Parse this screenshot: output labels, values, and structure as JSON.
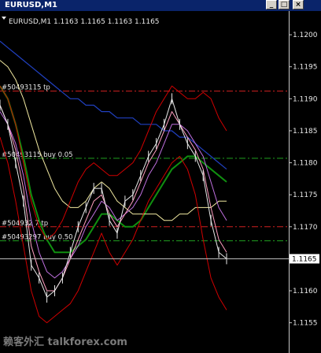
{
  "window": {
    "title": "EURUSD,M1",
    "min_label": "_",
    "max_label": "□",
    "close_label": "×"
  },
  "header": {
    "symbol_info": "EURUSD,M1  1.1163 1.1165 1.1163 1.1165"
  },
  "watermark": "赖客外汇 talkforex.com",
  "colors": {
    "background": "#000000",
    "price": "#e8e8e8",
    "bollinger": "#d00000",
    "ma_fast": "#ff9fc0",
    "ma_violet": "#c070e0",
    "ma_yellow": "#f0e8a0",
    "ma_green": "#109010",
    "ma_blue": "#2040c0",
    "tp_line": "#d02020",
    "buy_line": "#20a020"
  },
  "chart_data": {
    "type": "line",
    "title": "EURUSD,M1  1.1163 1.1165 1.1163 1.1165",
    "ylim": [
      1.1152,
      1.1201
    ],
    "yticks": [
      "1.1200",
      "1.1195",
      "1.1190",
      "1.1185",
      "1.1180",
      "1.1175",
      "1.1170",
      "1.1165",
      "1.1160",
      "1.1155"
    ],
    "current_price": "1.1165",
    "order_lines": [
      {
        "label": "#50493115 tp",
        "price": 1.11912,
        "kind": "tp"
      },
      {
        "label": "#50493115 buy 0.05",
        "price": 1.11807,
        "kind": "buy"
      },
      {
        "label": "#504932 7 tp",
        "price": 1.117,
        "kind": "tp"
      },
      {
        "label": "#50493297 buy 0.50",
        "price": 1.11678,
        "kind": "buy"
      }
    ],
    "x": [
      0,
      10,
      20,
      30,
      40,
      50,
      60,
      70,
      80,
      90,
      100,
      110,
      120,
      130,
      140,
      150,
      160,
      170,
      180,
      190,
      200,
      210,
      220,
      230,
      240,
      250,
      260,
      270,
      280,
      290
    ],
    "series": [
      {
        "role": "price",
        "values": [
          1.1189,
          1.1186,
          1.118,
          1.1174,
          1.1164,
          1.1162,
          1.1159,
          1.116,
          1.1162,
          1.1166,
          1.117,
          1.1173,
          1.1176,
          1.1176,
          1.1171,
          1.1169,
          1.1174,
          1.1175,
          1.1178,
          1.1181,
          1.1183,
          1.1186,
          1.119,
          1.1186,
          1.1183,
          1.1181,
          1.1178,
          1.1171,
          1.1166,
          1.1165
        ]
      },
      {
        "role": "bollinger_upper",
        "values": [
          1.1192,
          1.119,
          1.1186,
          1.118,
          1.1174,
          1.117,
          1.1168,
          1.1169,
          1.1171,
          1.1174,
          1.1177,
          1.1179,
          1.118,
          1.1179,
          1.1178,
          1.1178,
          1.1179,
          1.118,
          1.1182,
          1.1185,
          1.1188,
          1.119,
          1.1192,
          1.1191,
          1.119,
          1.119,
          1.1191,
          1.119,
          1.1187,
          1.1185
        ]
      },
      {
        "role": "bollinger_lower",
        "values": [
          1.1184,
          1.118,
          1.1174,
          1.1167,
          1.116,
          1.1156,
          1.1155,
          1.1156,
          1.1157,
          1.1158,
          1.116,
          1.1163,
          1.1166,
          1.1169,
          1.1166,
          1.1164,
          1.1166,
          1.1168,
          1.1171,
          1.1174,
          1.1176,
          1.1178,
          1.118,
          1.1181,
          1.1179,
          1.1175,
          1.1168,
          1.1162,
          1.1159,
          1.1157
        ]
      },
      {
        "role": "ma_fast",
        "values": [
          1.1189,
          1.1186,
          1.1182,
          1.1176,
          1.1167,
          1.1163,
          1.116,
          1.116,
          1.1162,
          1.1165,
          1.1168,
          1.1171,
          1.1174,
          1.1175,
          1.1172,
          1.117,
          1.1172,
          1.1174,
          1.1177,
          1.118,
          1.1182,
          1.1185,
          1.1188,
          1.1186,
          1.1184,
          1.1182,
          1.1179,
          1.1173,
          1.1168,
          1.1166
        ]
      },
      {
        "role": "ma_violet",
        "values": [
          1.1188,
          1.1186,
          1.1183,
          1.1178,
          1.1171,
          1.1166,
          1.1163,
          1.1162,
          1.1163,
          1.1165,
          1.1167,
          1.117,
          1.1172,
          1.1174,
          1.1173,
          1.1171,
          1.1172,
          1.1173,
          1.1175,
          1.1178,
          1.118,
          1.1183,
          1.1186,
          1.1186,
          1.1185,
          1.1183,
          1.1181,
          1.1177,
          1.1173,
          1.1171
        ]
      },
      {
        "role": "ma_yellow",
        "values": [
          1.1196,
          1.1195,
          1.1193,
          1.119,
          1.1186,
          1.1182,
          1.1179,
          1.1176,
          1.1174,
          1.1173,
          1.1173,
          1.1174,
          1.1176,
          1.1177,
          1.1176,
          1.1174,
          1.1173,
          1.1172,
          1.1172,
          1.1172,
          1.1172,
          1.1171,
          1.1171,
          1.1172,
          1.1172,
          1.1173,
          1.1173,
          1.1173,
          1.1174,
          1.1174
        ]
      },
      {
        "role": "ma_green",
        "values": [
          1.1192,
          1.119,
          1.1186,
          1.1181,
          1.1175,
          1.1171,
          1.1168,
          1.1166,
          1.1166,
          1.1166,
          1.1167,
          1.1168,
          1.117,
          1.1172,
          1.1172,
          1.1171,
          1.117,
          1.117,
          1.1171,
          1.1173,
          1.1175,
          1.1177,
          1.1179,
          1.118,
          1.1181,
          1.1181,
          1.118,
          1.1179,
          1.1178,
          1.1177
        ]
      },
      {
        "role": "ma_blue",
        "values": [
          1.1199,
          1.1198,
          1.1197,
          1.1196,
          1.1195,
          1.1194,
          1.1193,
          1.1192,
          1.1191,
          1.119,
          1.119,
          1.1189,
          1.1189,
          1.1188,
          1.1188,
          1.1187,
          1.1187,
          1.1187,
          1.1186,
          1.1186,
          1.1186,
          1.1185,
          1.1185,
          1.1184,
          1.1184,
          1.1183,
          1.1182,
          1.1181,
          1.118,
          1.1179
        ]
      }
    ]
  }
}
